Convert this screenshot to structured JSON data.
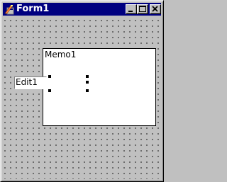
{
  "window": {
    "title": "Form1",
    "icon": "form-app-icon",
    "buttons": {
      "minimize": "minimize-icon",
      "maximize": "maximize-icon",
      "close": "close-icon"
    }
  },
  "form": {
    "grid": "dotted design grid"
  },
  "memo": {
    "text": "Memo1"
  },
  "edit": {
    "value": "Edit1"
  },
  "colors": {
    "titlebar": "#000080",
    "face": "#c0c0c0",
    "control_bg": "#ffffff"
  }
}
